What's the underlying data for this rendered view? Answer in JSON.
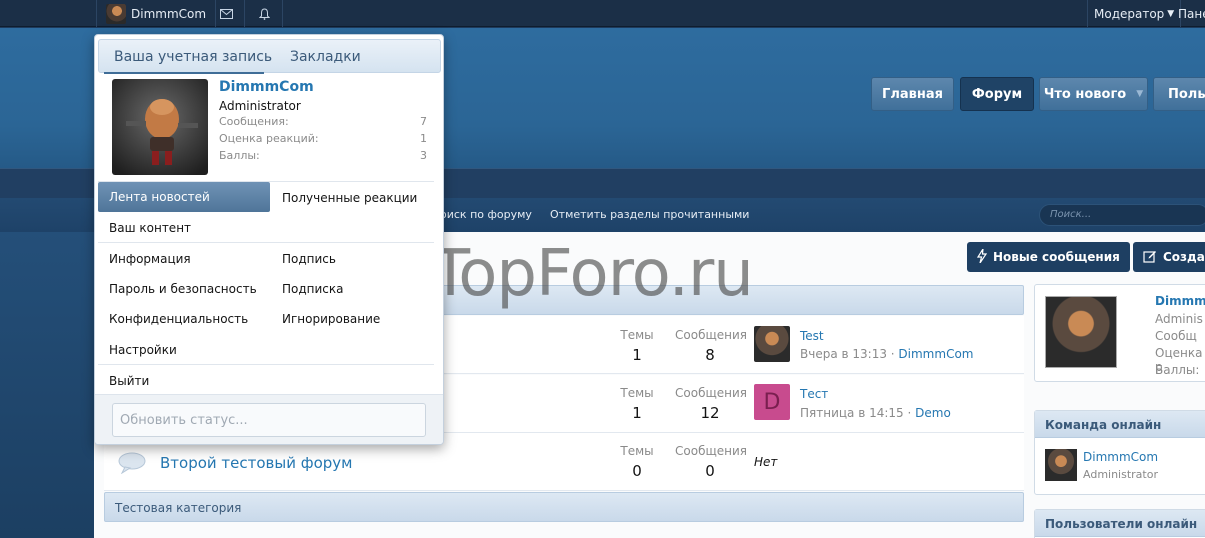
{
  "topbar": {
    "username": "DimmmCom",
    "moderator": "Модератор",
    "panel": "Пане"
  },
  "nav": {
    "home": "Главная",
    "forum": "Форум",
    "whats_new": "Что нового",
    "users": "Польз"
  },
  "subnav": {
    "search_forum": "оиск по форуму",
    "mark_read": "Отметить разделы прочитанными",
    "search_placeholder": "Поиск..."
  },
  "buttons": {
    "new_posts": "Новые сообщения",
    "create": "Созда"
  },
  "nodes": [
    {
      "title": "",
      "threads_label": "Темы",
      "threads": "1",
      "messages_label": "Сообщения",
      "messages": "8",
      "last_title": "Test",
      "last_time": "Вчера в 13:13",
      "last_user": "DimmmCom"
    },
    {
      "title": "",
      "threads_label": "Темы",
      "threads": "1",
      "messages_label": "Сообщения",
      "messages": "12",
      "last_title": "Тест",
      "last_time": "Пятница в 14:15",
      "last_user": "Demo",
      "avatar_letter": "D"
    },
    {
      "title": "Второй тестовый форум",
      "threads_label": "Темы",
      "threads": "0",
      "messages_label": "Сообщения",
      "messages": "0",
      "last_none": "Нет"
    }
  ],
  "category2": "Тестовая категория",
  "sidebar": {
    "user_name": "Dimmm",
    "user_role": "Adminis",
    "user_msgs": "Сообщ",
    "user_react": "Оценка р",
    "user_points": "Баллы:",
    "staff_online_title": "Команда онлайн",
    "staff_name": "DimmmCom",
    "staff_role": "Administrator",
    "users_online_title": "Пользователи онлайн"
  },
  "menu": {
    "tab_account": "Ваша учетная запись",
    "tab_bookmarks": "Закладки",
    "name": "DimmmCom",
    "role": "Administrator",
    "stats": [
      {
        "label": "Сообщения:",
        "value": "7"
      },
      {
        "label": "Оценка реакций:",
        "value": "1"
      },
      {
        "label": "Баллы:",
        "value": "3"
      }
    ],
    "news_feed": "Лента новостей",
    "reactions_received": "Полученные реакции",
    "your_content": "Ваш контент",
    "information": "Информация",
    "signature": "Подпись",
    "password_security": "Пароль и безопасность",
    "subscription": "Подписка",
    "privacy": "Конфиденциальность",
    "ignoring": "Игнорирование",
    "settings": "Настройки",
    "logout": "Выйти",
    "status_placeholder": "Обновить статус..."
  },
  "watermark": "TopForo.ru"
}
